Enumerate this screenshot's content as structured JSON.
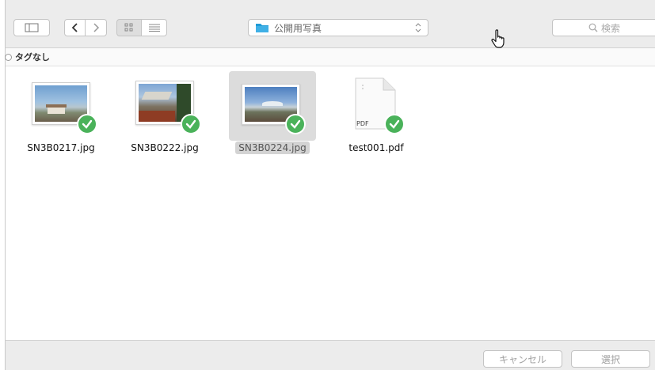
{
  "toolbar": {
    "path_folder": "公開用写真",
    "search_placeholder": "検索"
  },
  "tagbar": {
    "label": "タグなし"
  },
  "files": [
    {
      "name": "SN3B0217.jpg",
      "icon": "photo-thumbnail",
      "status": "checked",
      "selected": false
    },
    {
      "name": "SN3B0222.jpg",
      "icon": "photo-thumbnail",
      "status": "checked",
      "selected": false
    },
    {
      "name": "SN3B0224.jpg",
      "icon": "photo-thumbnail",
      "status": "checked",
      "selected": true
    },
    {
      "name": "test001.pdf",
      "icon": "pdf-document",
      "badge": "PDF",
      "status": "checked",
      "selected": false
    }
  ],
  "footer": {
    "cancel_label": "キャンセル",
    "choose_label": "選択"
  },
  "colors": {
    "check_green": "#4ab25a",
    "folder_blue": "#1f9bd7"
  }
}
